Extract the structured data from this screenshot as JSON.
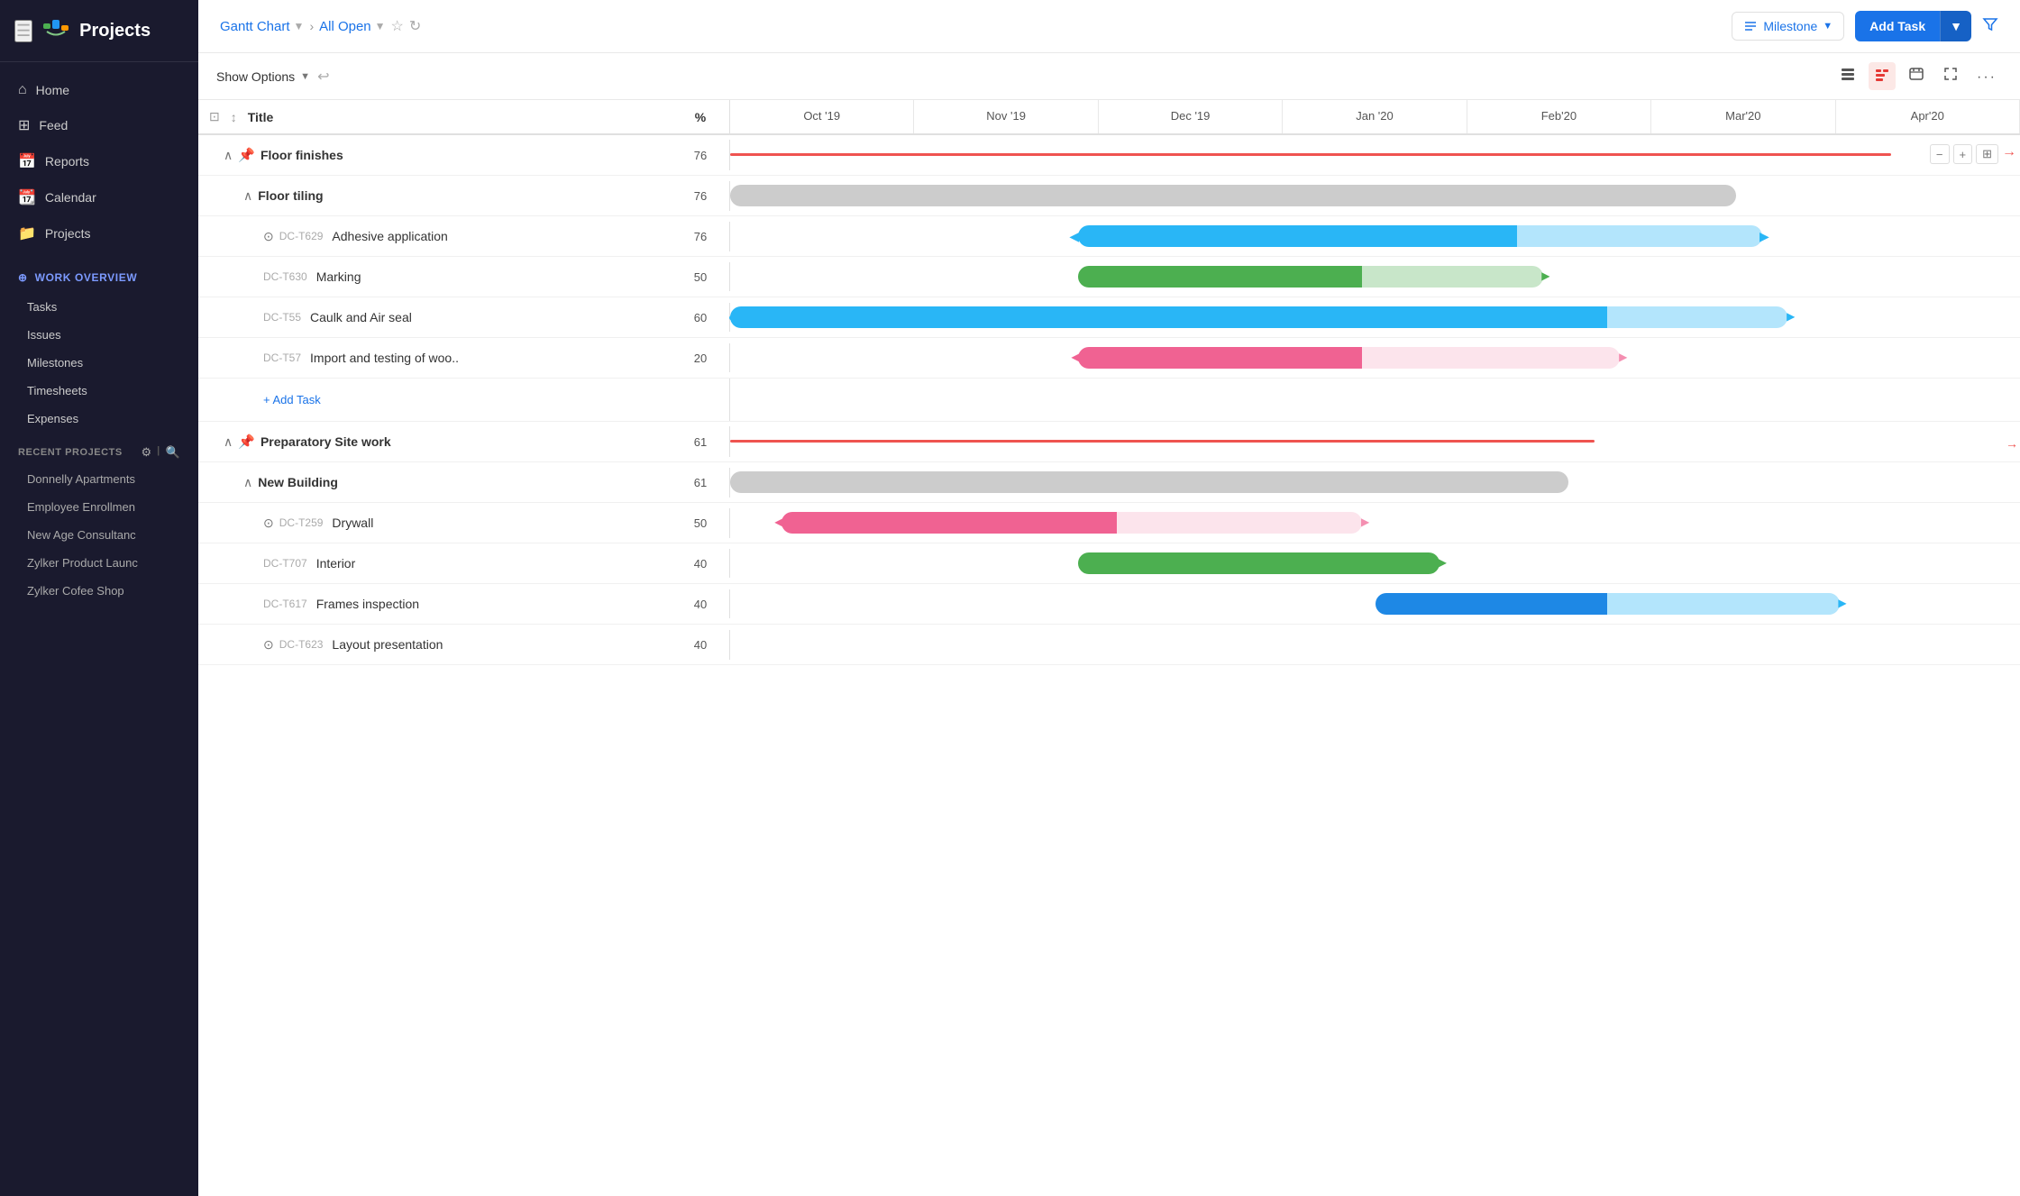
{
  "sidebar": {
    "title": "Projects",
    "hamburger": "☰",
    "nav": [
      {
        "id": "home",
        "icon": "⌂",
        "label": "Home"
      },
      {
        "id": "feed",
        "icon": "⊞",
        "label": "Feed"
      },
      {
        "id": "reports",
        "icon": "📅",
        "label": "Reports"
      },
      {
        "id": "calendar",
        "icon": "📆",
        "label": "Calendar"
      },
      {
        "id": "projects",
        "icon": "📁",
        "label": "Projects"
      }
    ],
    "work_overview": {
      "label": "WORK OVERVIEW",
      "items": [
        "Tasks",
        "Issues",
        "Milestones",
        "Timesheets",
        "Expenses"
      ]
    },
    "recent_projects": {
      "label": "RECENT PROJECTS",
      "items": [
        "Donnelly Apartments",
        "Employee Enrollmen",
        "New Age Consultanc",
        "Zylker Product Launc",
        "Zylker Cofee Shop"
      ]
    }
  },
  "topbar": {
    "breadcrumb_main": "Gantt Chart",
    "breadcrumb_filter": "All Open",
    "milestone_label": "Milestone",
    "add_task_label": "Add Task",
    "filter_icon": "▽"
  },
  "toolbar": {
    "show_options_label": "Show Options",
    "undo_icon": "↩"
  },
  "gantt": {
    "columns": {
      "title_label": "Title",
      "percent_label": "%"
    },
    "months": [
      "Oct '19",
      "Nov '19",
      "Dec '19",
      "Jan '20",
      "Feb'20",
      "Mar'20",
      "Apr'20"
    ],
    "rows": [
      {
        "id": "floor-finishes",
        "indent": 1,
        "chevron": true,
        "pin_icon": true,
        "task_id": "",
        "title": "Floor finishes",
        "title_class": "group",
        "percent": "76",
        "bar_type": "red-line",
        "bar_left_pct": 0,
        "bar_width_pct": 90
      },
      {
        "id": "floor-tiling",
        "indent": 2,
        "chevron": true,
        "task_id": "",
        "title": "Floor tiling",
        "title_class": "group",
        "percent": "76",
        "bar_type": "gray",
        "bar_left_pct": 0,
        "bar_width_pct": 78
      },
      {
        "id": "dc-t629",
        "indent": 3,
        "chevron": true,
        "task_id": "DC-T629",
        "title": "Adhesive application",
        "title_class": "",
        "percent": "76",
        "bar_type": "blue-split",
        "bar_left_pct": 27,
        "bar_width_pct": 52
      },
      {
        "id": "dc-t630",
        "indent": 3,
        "task_id": "DC-T630",
        "title": "Marking",
        "title_class": "",
        "percent": "50",
        "bar_type": "green-split",
        "bar_left_pct": 27,
        "bar_width_pct": 36
      },
      {
        "id": "dc-t55",
        "indent": 3,
        "task_id": "DC-T55",
        "title": "Caulk and Air seal",
        "title_class": "",
        "percent": "60",
        "bar_type": "blue-split",
        "bar_left_pct": 0,
        "bar_width_pct": 72
      },
      {
        "id": "dc-t57",
        "indent": 3,
        "task_id": "DC-T57",
        "title": "Import and testing of woo..",
        "title_class": "",
        "percent": "20",
        "bar_type": "pink-split",
        "bar_left_pct": 27,
        "bar_width_pct": 42
      },
      {
        "id": "add-task-floor",
        "type": "add-task",
        "indent": 3,
        "label": "Add Task"
      },
      {
        "id": "prep-site",
        "indent": 1,
        "chevron": true,
        "pin_icon": true,
        "task_id": "",
        "title": "Preparatory Site work",
        "title_class": "group",
        "percent": "61",
        "bar_type": "red-line-full",
        "bar_left_pct": 0,
        "bar_width_pct": 100
      },
      {
        "id": "new-building",
        "indent": 2,
        "chevron": true,
        "task_id": "",
        "title": "New Building",
        "title_class": "group",
        "percent": "61",
        "bar_type": "gray",
        "bar_left_pct": 0,
        "bar_width_pct": 65
      },
      {
        "id": "dc-t259",
        "indent": 3,
        "chevron": true,
        "task_id": "DC-T259",
        "title": "Drywall",
        "title_class": "",
        "percent": "50",
        "bar_type": "pink-split",
        "bar_left_pct": 4,
        "bar_width_pct": 45
      },
      {
        "id": "dc-t707",
        "indent": 3,
        "task_id": "DC-T707",
        "title": "Interior",
        "title_class": "",
        "percent": "40",
        "bar_type": "green",
        "bar_left_pct": 27,
        "bar_width_pct": 35
      },
      {
        "id": "dc-t617",
        "indent": 3,
        "task_id": "DC-T617",
        "title": "Frames inspection",
        "title_class": "",
        "percent": "40",
        "bar_type": "blue-split2",
        "bar_left_pct": 50,
        "bar_width_pct": 36
      },
      {
        "id": "dc-t623",
        "indent": 3,
        "chevron": true,
        "task_id": "DC-T623",
        "title": "Layout presentation",
        "title_class": "",
        "percent": "40",
        "bar_type": "none",
        "bar_left_pct": 0,
        "bar_width_pct": 0
      }
    ]
  }
}
